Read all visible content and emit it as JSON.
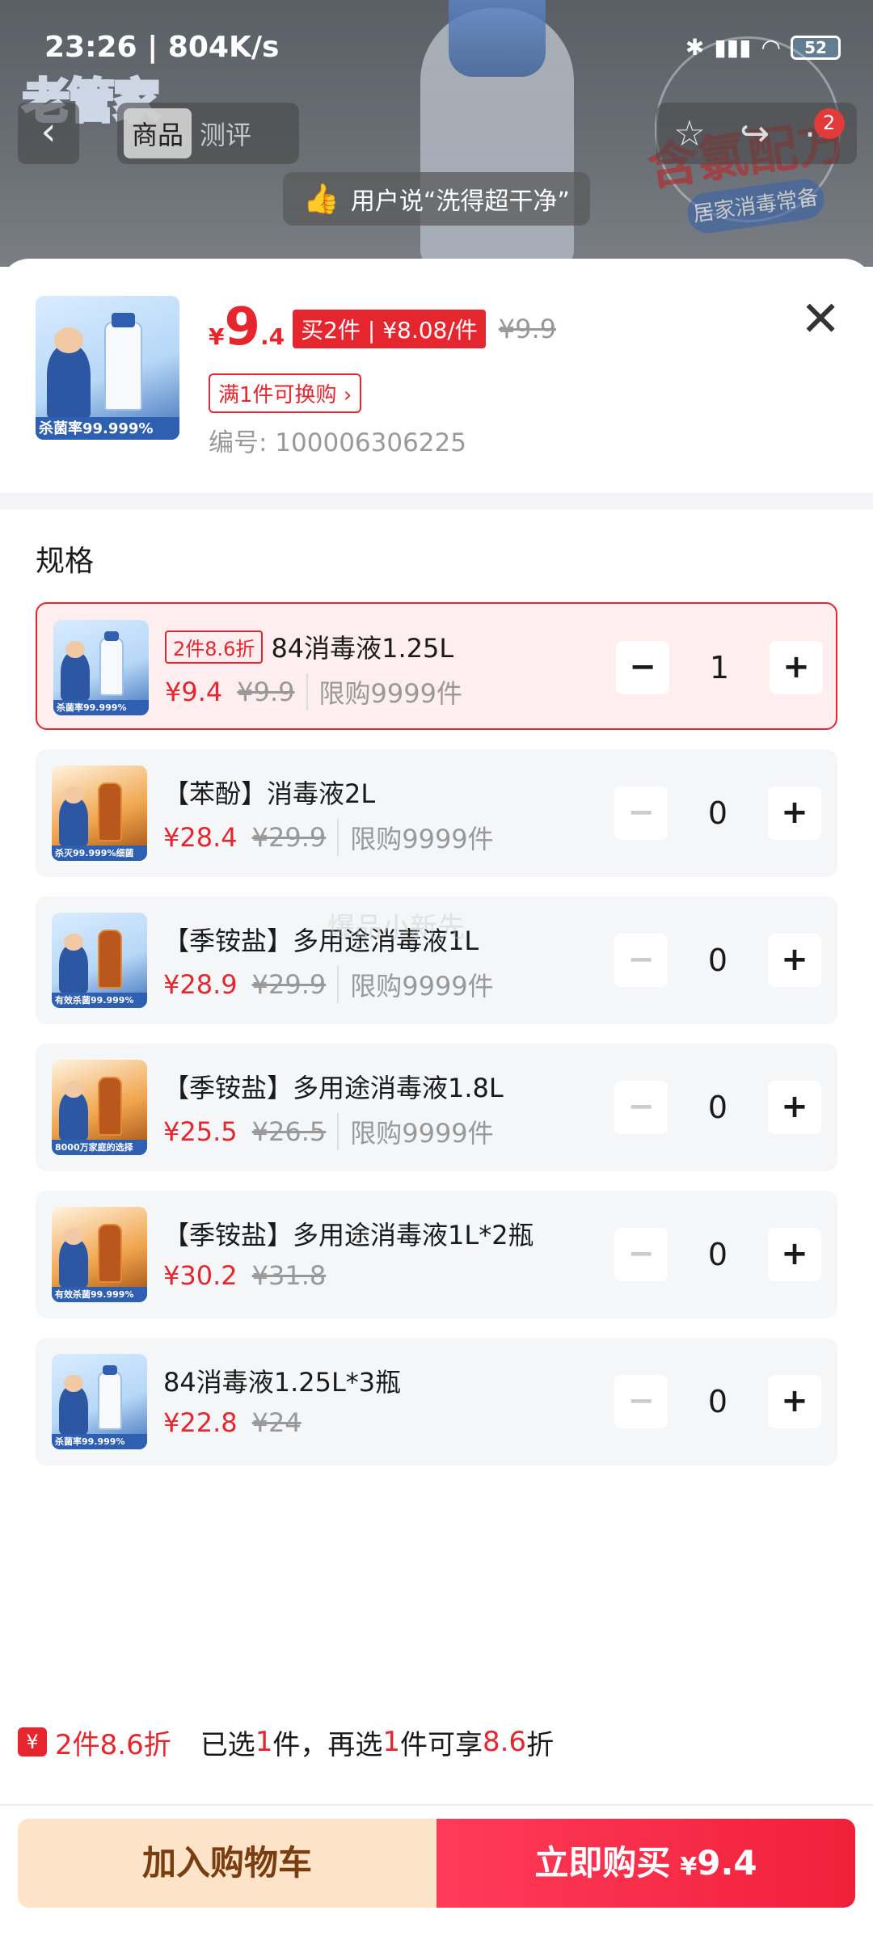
{
  "status_bar": {
    "time": "23:26 | 804K/s",
    "battery": "52"
  },
  "nav": {
    "tabs": [
      "商品",
      "测评"
    ],
    "cart_badge": "2"
  },
  "review_pill": {
    "text": "用户说“洗得超干净”"
  },
  "product": {
    "price_currency": "¥",
    "price_int": "9",
    "price_dec": ".4",
    "promo_badge": "买2件 | ¥8.08/件",
    "original_price": "¥9.9",
    "exchange_tag": "满1件可换购",
    "sku_number": "编号: 100006306225",
    "thumb_text": "杀菌率99.999%"
  },
  "spec": {
    "title": "规格",
    "items": [
      {
        "discount_tag": "2件8.6折",
        "name": "84消毒液1.25L",
        "price": "¥9.4",
        "original": "¥9.9",
        "limit": "限购9999件",
        "qty": "1",
        "thumb_text": "杀菌率99.999%",
        "thumb_style": "blue"
      },
      {
        "discount_tag": "",
        "name": "【苯酚】消毒液2L",
        "price": "¥28.4",
        "original": "¥29.9",
        "limit": "限购9999件",
        "qty": "0",
        "thumb_text": "杀灭99.999%细菌",
        "thumb_style": "orange"
      },
      {
        "discount_tag": "",
        "name": "【季铵盐】多用途消毒液1L",
        "price": "¥28.9",
        "original": "¥29.9",
        "limit": "限购9999件",
        "qty": "0",
        "thumb_text": "有效杀菌99.999%",
        "thumb_style": "orange"
      },
      {
        "discount_tag": "",
        "name": "【季铵盐】多用途消毒液1.8L",
        "price": "¥25.5",
        "original": "¥26.5",
        "limit": "限购9999件",
        "qty": "0",
        "thumb_text": "8000万家庭的选择",
        "thumb_style": "orange"
      },
      {
        "discount_tag": "",
        "name": "【季铵盐】多用途消毒液1L*2瓶",
        "price": "¥30.2",
        "original": "¥31.8",
        "limit": "",
        "qty": "0",
        "thumb_text": "有效杀菌99.999%",
        "thumb_style": "orange"
      },
      {
        "discount_tag": "",
        "name": "84消毒液1.25L*3瓶",
        "price": "¥22.8",
        "original": "¥24",
        "limit": "",
        "qty": "0",
        "thumb_text": "杀菌率99.999%",
        "thumb_style": "blue"
      }
    ]
  },
  "watermark": "爆品小新先",
  "promo_bar": {
    "tag": "2件8.6折",
    "text_a": "已选",
    "count_a": "1",
    "text_b": "件，再选",
    "count_b": "1",
    "text_c": "件可享",
    "discount": "8.6",
    "text_d": "折"
  },
  "buttons": {
    "add_to_cart": "加入购物车",
    "buy_now": "立即购买",
    "buy_currency": "¥",
    "buy_price": "9.4"
  },
  "colors": {
    "accent": "#e5262f",
    "cart_button": "#fde3c8",
    "buy_button": "#f0203a"
  }
}
